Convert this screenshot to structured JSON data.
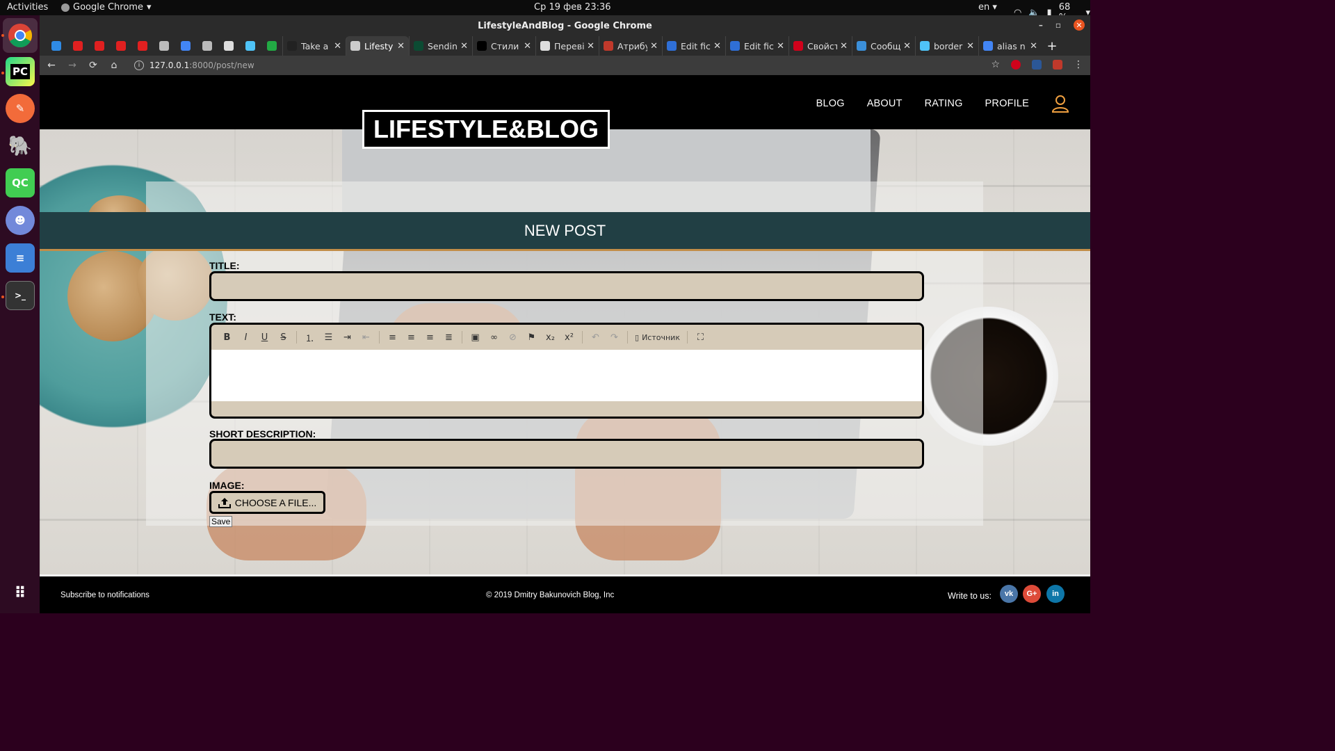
{
  "os": {
    "activities": "Activities",
    "app_name": "Google Chrome",
    "datetime": "Ср 19 фев  23:36",
    "lang": "en",
    "battery": "68 %"
  },
  "window": {
    "title": "LifestyleAndBlog - Google Chrome"
  },
  "tabs": [
    {
      "label": "Take a",
      "favicon_color": "#222222"
    },
    {
      "label": "Lifesty",
      "favicon_color": "#cccccc",
      "active": true
    },
    {
      "label": "Sendin",
      "favicon_color": "#0c4b33"
    },
    {
      "label": "Стили",
      "favicon_color": "#000000"
    },
    {
      "label": "Переві",
      "favicon_color": "#dddddd"
    },
    {
      "label": "Атрибу",
      "favicon_color": "#c0392b"
    },
    {
      "label": "Edit fic",
      "favicon_color": "#2f6fd6"
    },
    {
      "label": "Edit fic",
      "favicon_color": "#2f6fd6"
    },
    {
      "label": "Свойст",
      "favicon_color": "#d0021b"
    },
    {
      "label": "Сообщ",
      "favicon_color": "#3b8fd9"
    },
    {
      "label": "border",
      "favicon_color": "#4fc3f7"
    },
    {
      "label": "alias n",
      "favicon_color": "#4285f4"
    }
  ],
  "pinned_tabs": [
    "#2f8be6",
    "#e02020",
    "#e02020",
    "#e02020",
    "#e02020",
    "#bbbbbb",
    "#4285f4",
    "#bbbbbb",
    "#dddddd",
    "#4fc3f7",
    "#22aa44"
  ],
  "address": {
    "host": "127.0.0.1",
    "path": ":8000/post/new"
  },
  "site": {
    "logo": "LIFESTYLE&BLOG",
    "nav": [
      "BLOG",
      "ABOUT",
      "RATING",
      "PROFILE"
    ],
    "banner": "NEW POST"
  },
  "form": {
    "title_label": "TITLE:",
    "text_label": "TEXT:",
    "source_label": "Источник",
    "short_label": "SHORT DESCRIPTION:",
    "image_label": "IMAGE:",
    "choose_label": "CHOOSE A FILE...",
    "save_label": "Save"
  },
  "footer": {
    "subscribe": "Subscribe to notifications",
    "copyright": "© 2019 Dmitry Bakunovich Blog, Inc",
    "write": "Write to us:",
    "social": [
      {
        "name": "vk",
        "glyph": "vk",
        "color": "#4a76a8"
      },
      {
        "name": "google-plus",
        "glyph": "G+",
        "color": "#dd4b39"
      },
      {
        "name": "linkedin",
        "glyph": "in",
        "color": "#0e76a8"
      }
    ]
  }
}
